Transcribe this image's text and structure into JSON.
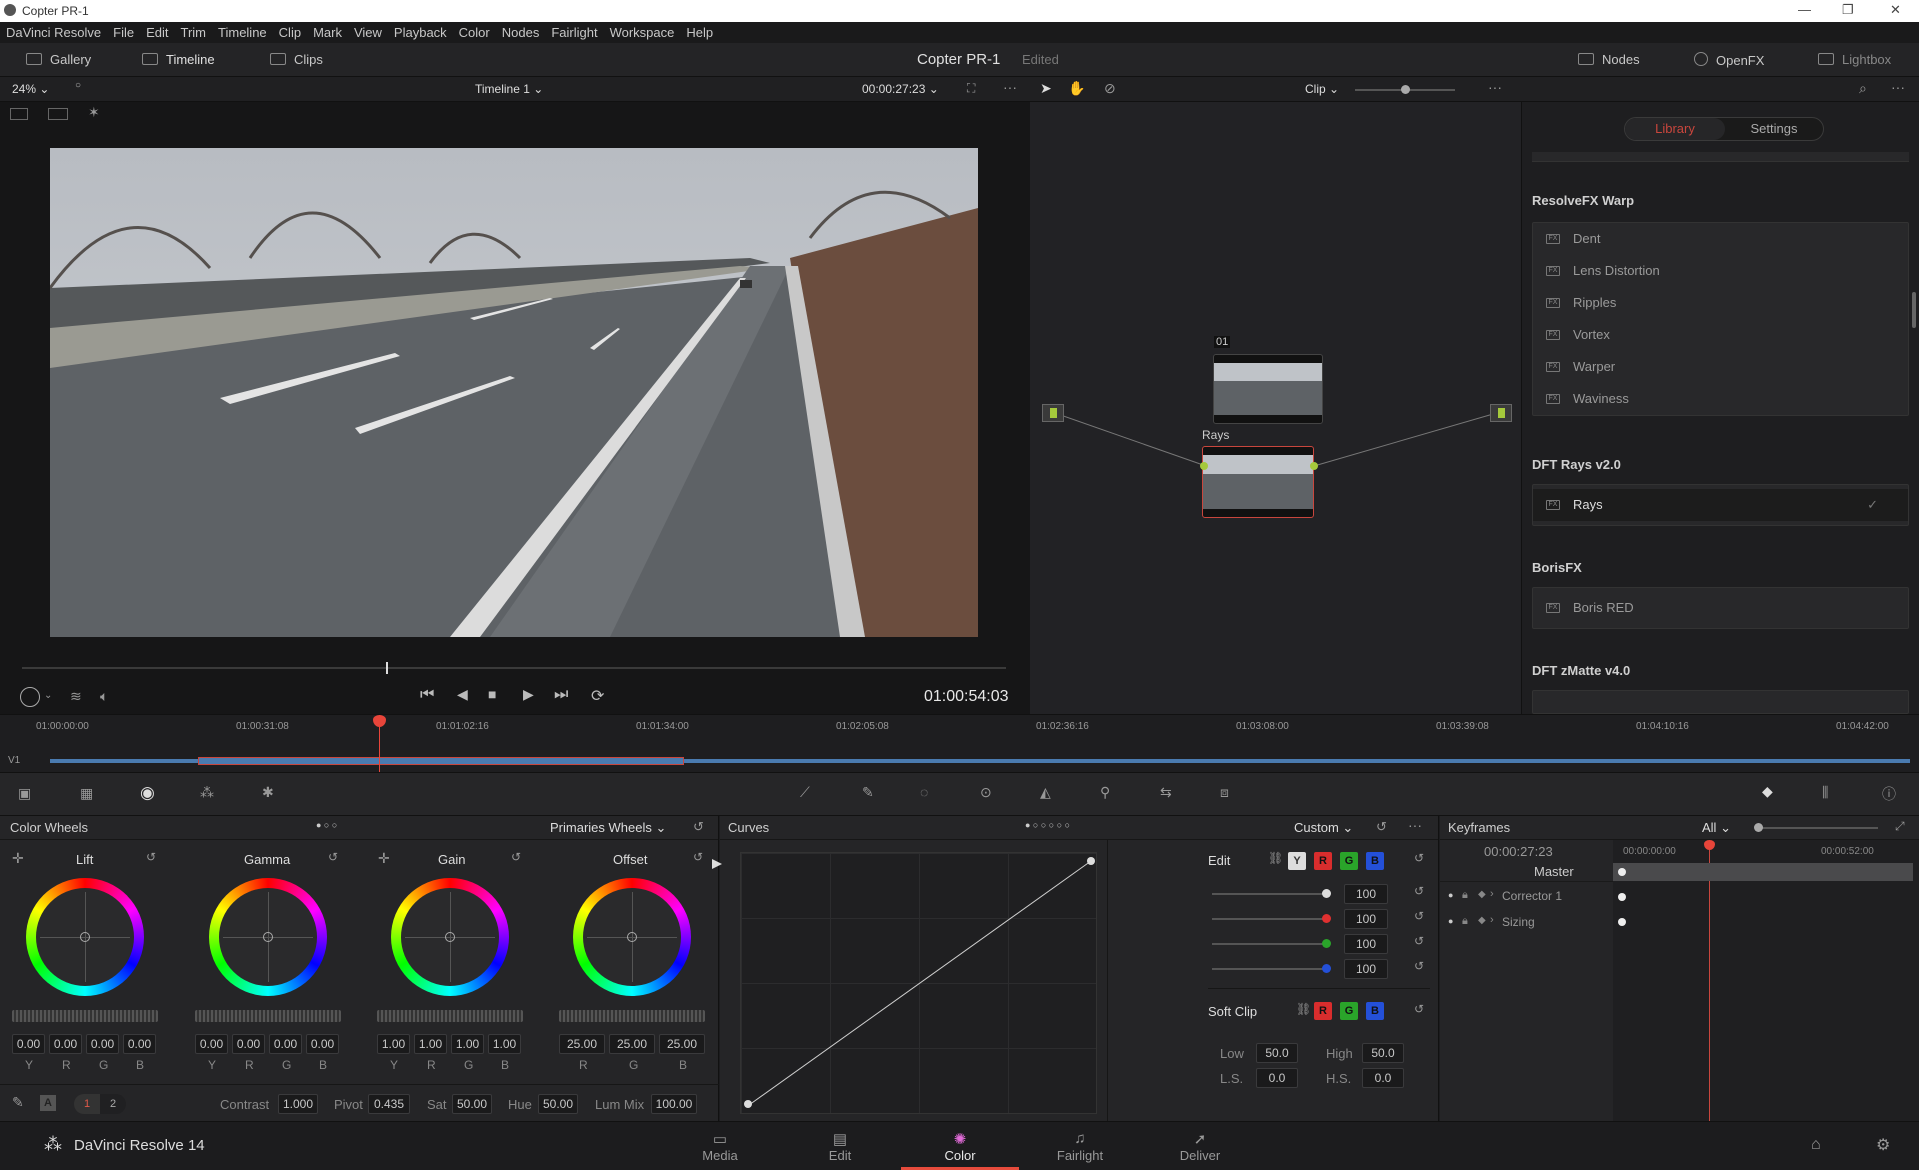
{
  "window": {
    "title": "Copter PR-1"
  },
  "menu": [
    "DaVinci Resolve",
    "File",
    "Edit",
    "Trim",
    "Timeline",
    "Clip",
    "Mark",
    "View",
    "Playback",
    "Color",
    "Nodes",
    "Fairlight",
    "Workspace",
    "Help"
  ],
  "toolbar": {
    "gallery": "Gallery",
    "timeline": "Timeline",
    "clips": "Clips",
    "project": "Copter PR-1",
    "status": "Edited",
    "nodes": "Nodes",
    "openfx": "OpenFX",
    "lightbox": "Lightbox"
  },
  "viewer": {
    "zoom": "24%",
    "timeline_name": "Timeline 1",
    "timecode": "00:00:27:23",
    "playhead_tc": "01:00:54:03",
    "playhead_progress": 0.37
  },
  "nodes": {
    "mode": "Clip",
    "node1_label": "01",
    "node2_label": "Rays"
  },
  "library": {
    "tabs": [
      "Library",
      "Settings"
    ],
    "active_tab": "Library",
    "sections": [
      {
        "title": "ResolveFX Warp",
        "items": [
          "Dent",
          "Lens Distortion",
          "Ripples",
          "Vortex",
          "Warper",
          "Waviness"
        ]
      },
      {
        "title": "DFT Rays v2.0",
        "items": [
          "Rays"
        ]
      },
      {
        "title": "BorisFX",
        "items": [
          "Boris RED"
        ]
      },
      {
        "title": "DFT zMatte v4.0",
        "items": []
      }
    ]
  },
  "timeline": {
    "track": "V1",
    "ticks": [
      "01:00:00:00",
      "01:00:31:08",
      "01:01:02:16",
      "01:01:34:00",
      "01:02:05:08",
      "01:02:36:16",
      "01:03:08:00",
      "01:03:39:08",
      "01:04:10:16",
      "01:04:42:00"
    ]
  },
  "wheels": {
    "title": "Color Wheels",
    "mode": "Primaries Wheels",
    "items": [
      {
        "name": "Lift",
        "values": [
          "0.00",
          "0.00",
          "0.00",
          "0.00"
        ],
        "channels": [
          "Y",
          "R",
          "G",
          "B"
        ]
      },
      {
        "name": "Gamma",
        "values": [
          "0.00",
          "0.00",
          "0.00",
          "0.00"
        ],
        "channels": [
          "Y",
          "R",
          "G",
          "B"
        ]
      },
      {
        "name": "Gain",
        "values": [
          "1.00",
          "1.00",
          "1.00",
          "1.00"
        ],
        "channels": [
          "Y",
          "R",
          "G",
          "B"
        ]
      },
      {
        "name": "Offset",
        "values": [
          "25.00",
          "25.00",
          "25.00"
        ],
        "channels": [
          "R",
          "G",
          "B"
        ]
      }
    ],
    "footer": {
      "page1": "1",
      "page2": "2",
      "contrast_label": "Contrast",
      "contrast": "1.000",
      "pivot_label": "Pivot",
      "pivot": "0.435",
      "sat_label": "Sat",
      "sat": "50.00",
      "hue_label": "Hue",
      "hue": "50.00",
      "lummix_label": "Lum Mix",
      "lummix": "100.00"
    }
  },
  "curves": {
    "title": "Curves",
    "preset": "Custom",
    "edit_label": "Edit",
    "channels": [
      "Y",
      "R",
      "G",
      "B"
    ],
    "intensity": [
      "100",
      "100",
      "100",
      "100"
    ],
    "softclip_label": "Soft Clip",
    "low_label": "Low",
    "low": "50.0",
    "high_label": "High",
    "high": "50.0",
    "ls_label": "L.S.",
    "ls": "0.0",
    "hs_label": "H.S.",
    "hs": "0.0"
  },
  "keyframes": {
    "title": "Keyframes",
    "filter": "All",
    "timecode": "00:00:27:23",
    "t0": "00:00:00:00",
    "t1": "00:00:52:00",
    "rows": [
      "Master",
      "Corrector 1",
      "Sizing"
    ]
  },
  "bottom": {
    "app": "DaVinci Resolve 14",
    "pages": [
      "Media",
      "Edit",
      "Color",
      "Fairlight",
      "Deliver"
    ],
    "active_page": "Color"
  },
  "colors": {
    "accent": "#e64b3c",
    "playhead": "#e8453a",
    "active_tab": "#c9463d"
  }
}
